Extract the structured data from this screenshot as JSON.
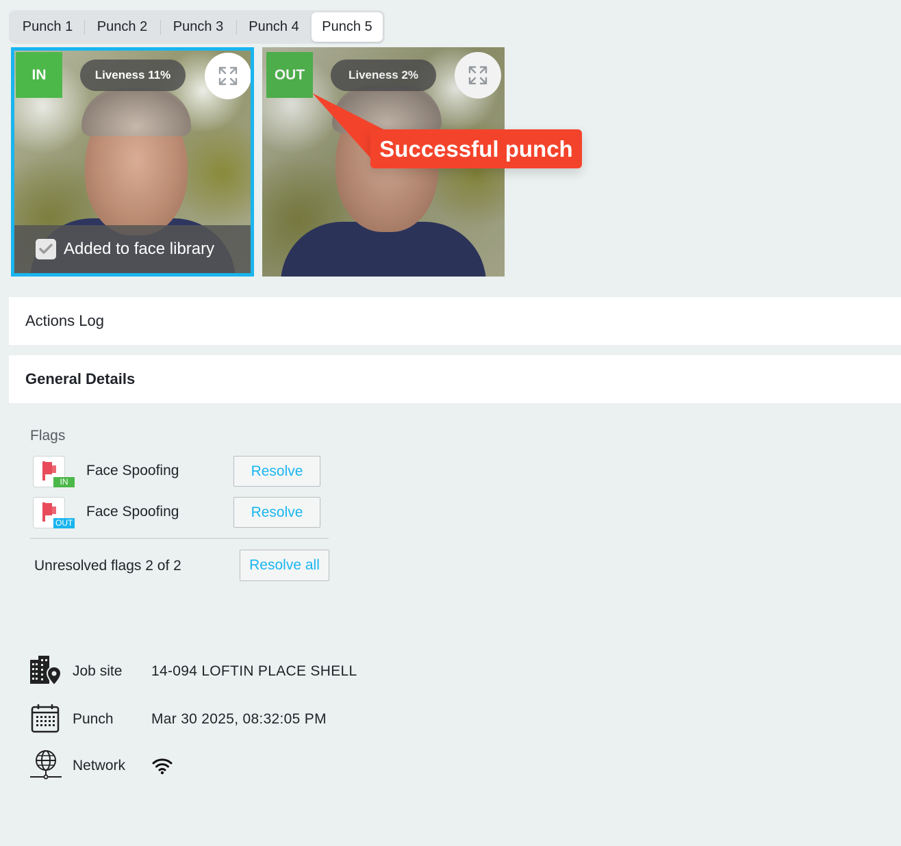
{
  "tabs": [
    {
      "label": "Punch 1",
      "active": false
    },
    {
      "label": "Punch 2",
      "active": false
    },
    {
      "label": "Punch 3",
      "active": false
    },
    {
      "label": "Punch 4",
      "active": false
    },
    {
      "label": "Punch 5",
      "active": true
    }
  ],
  "photos": {
    "in": {
      "direction": "IN",
      "liveness": "Liveness 11%",
      "face_library": "Added to face library",
      "face_library_checked": true,
      "badge_color": "#4cb84a",
      "border_color": "#19b5ee"
    },
    "out": {
      "direction": "OUT",
      "liveness": "Liveness 2%",
      "badge_color": "#4cb84a"
    }
  },
  "annotation": {
    "text": "Successful punch",
    "color": "#f4432b"
  },
  "sections": {
    "actions_log": "Actions Log",
    "general_details": "General Details"
  },
  "flags": {
    "title": "Flags",
    "items": [
      {
        "label": "Face Spoofing",
        "tag": "IN",
        "tag_color": "#4cb84a",
        "action": "Resolve"
      },
      {
        "label": "Face Spoofing",
        "tag": "OUT",
        "tag_color": "#19b5ee",
        "action": "Resolve"
      }
    ],
    "unresolved": "Unresolved flags 2 of 2",
    "resolve_all": "Resolve all"
  },
  "details": {
    "job_site": {
      "label": "Job site",
      "value": "14-094 LOFTIN PLACE SHELL",
      "icon": "building-location-icon"
    },
    "punch": {
      "label": "Punch",
      "value": "Mar 30 2025, 08:32:05 PM",
      "icon": "calendar-icon"
    },
    "network": {
      "label": "Network",
      "icon": "network-globe-icon",
      "value_icon": "wifi-icon"
    }
  }
}
